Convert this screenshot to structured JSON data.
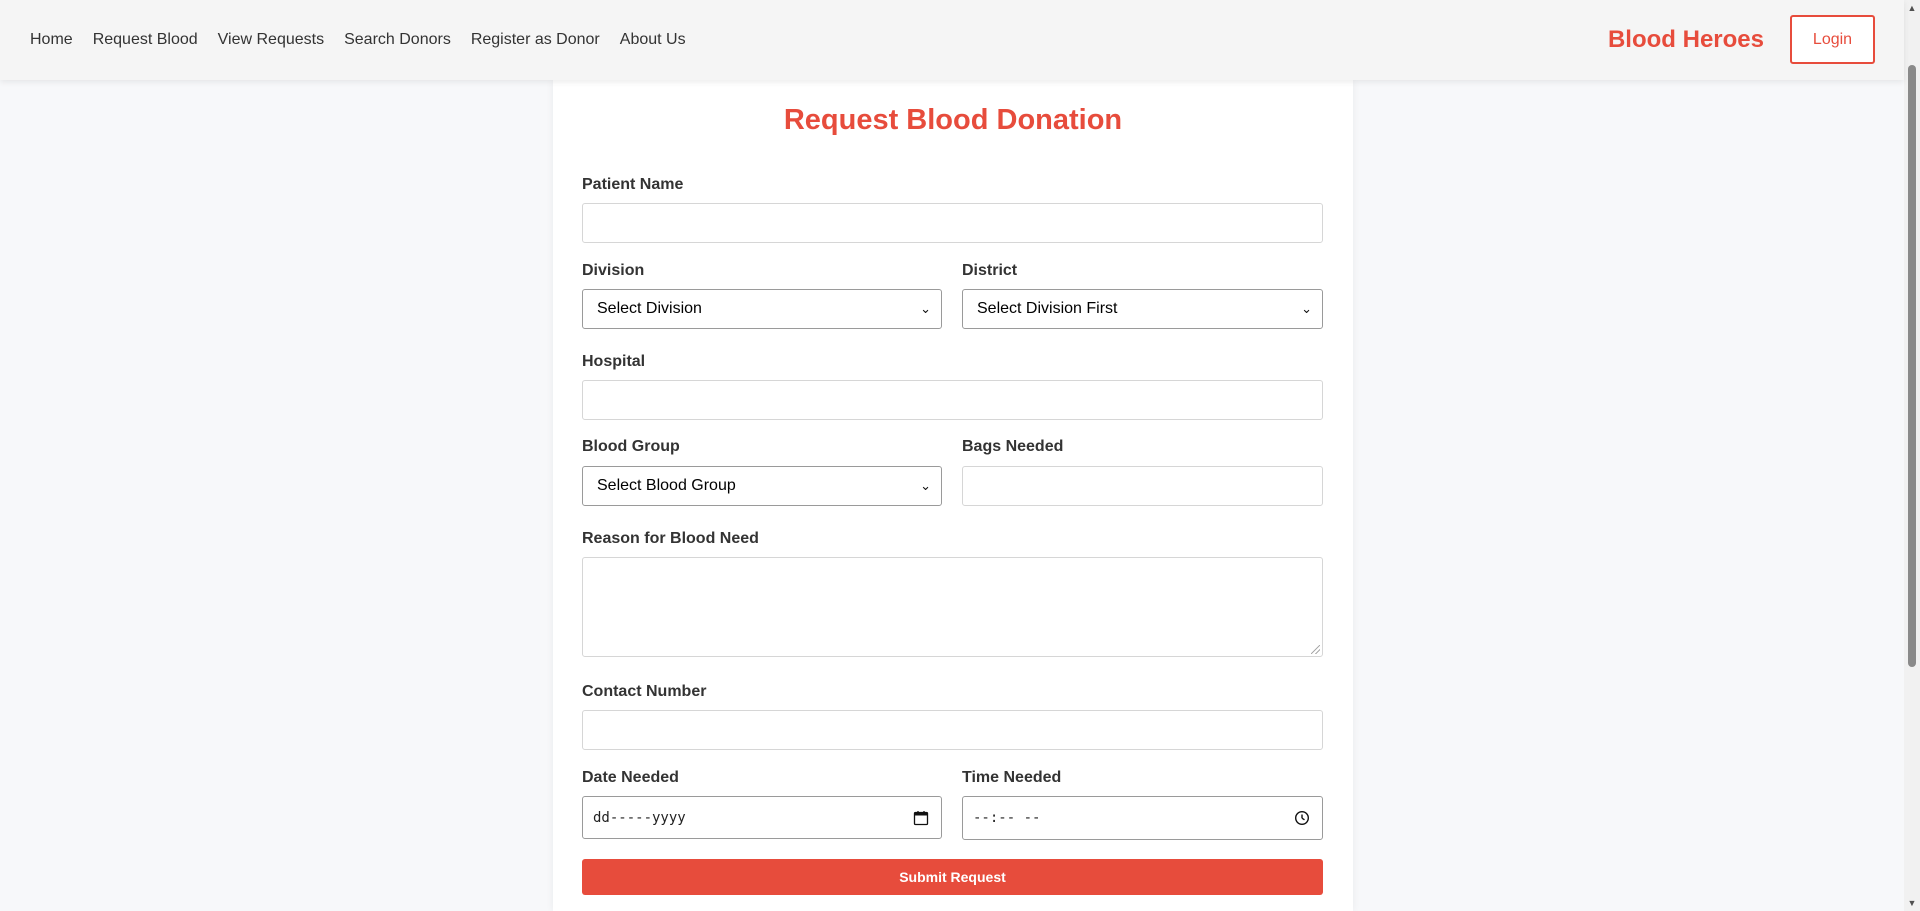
{
  "nav": {
    "links": [
      "Home",
      "Request Blood",
      "View Requests",
      "Search Donors",
      "Register as Donor",
      "About Us"
    ],
    "brand": "Blood Heroes",
    "login_label": "Login"
  },
  "form": {
    "title": "Request Blood Donation",
    "patient_name_label": "Patient Name",
    "patient_name_value": "",
    "division_label": "Division",
    "division_selected": "Select Division",
    "district_label": "District",
    "district_selected": "Select Division First",
    "hospital_label": "Hospital",
    "hospital_value": "",
    "blood_group_label": "Blood Group",
    "blood_group_selected": "Select Blood Group",
    "bags_label": "Bags Needed",
    "bags_value": "",
    "reason_label": "Reason for Blood Need",
    "reason_value": "",
    "contact_label": "Contact Number",
    "contact_value": "",
    "date_label": "Date Needed",
    "date_placeholder": "dd-----yyyy",
    "time_label": "Time Needed",
    "time_placeholder": "--:-- --",
    "submit_label": "Submit Request"
  },
  "colors": {
    "accent": "#e74c3c",
    "page_bg": "#f7f8fa",
    "nav_bg": "#f5f5f5"
  }
}
